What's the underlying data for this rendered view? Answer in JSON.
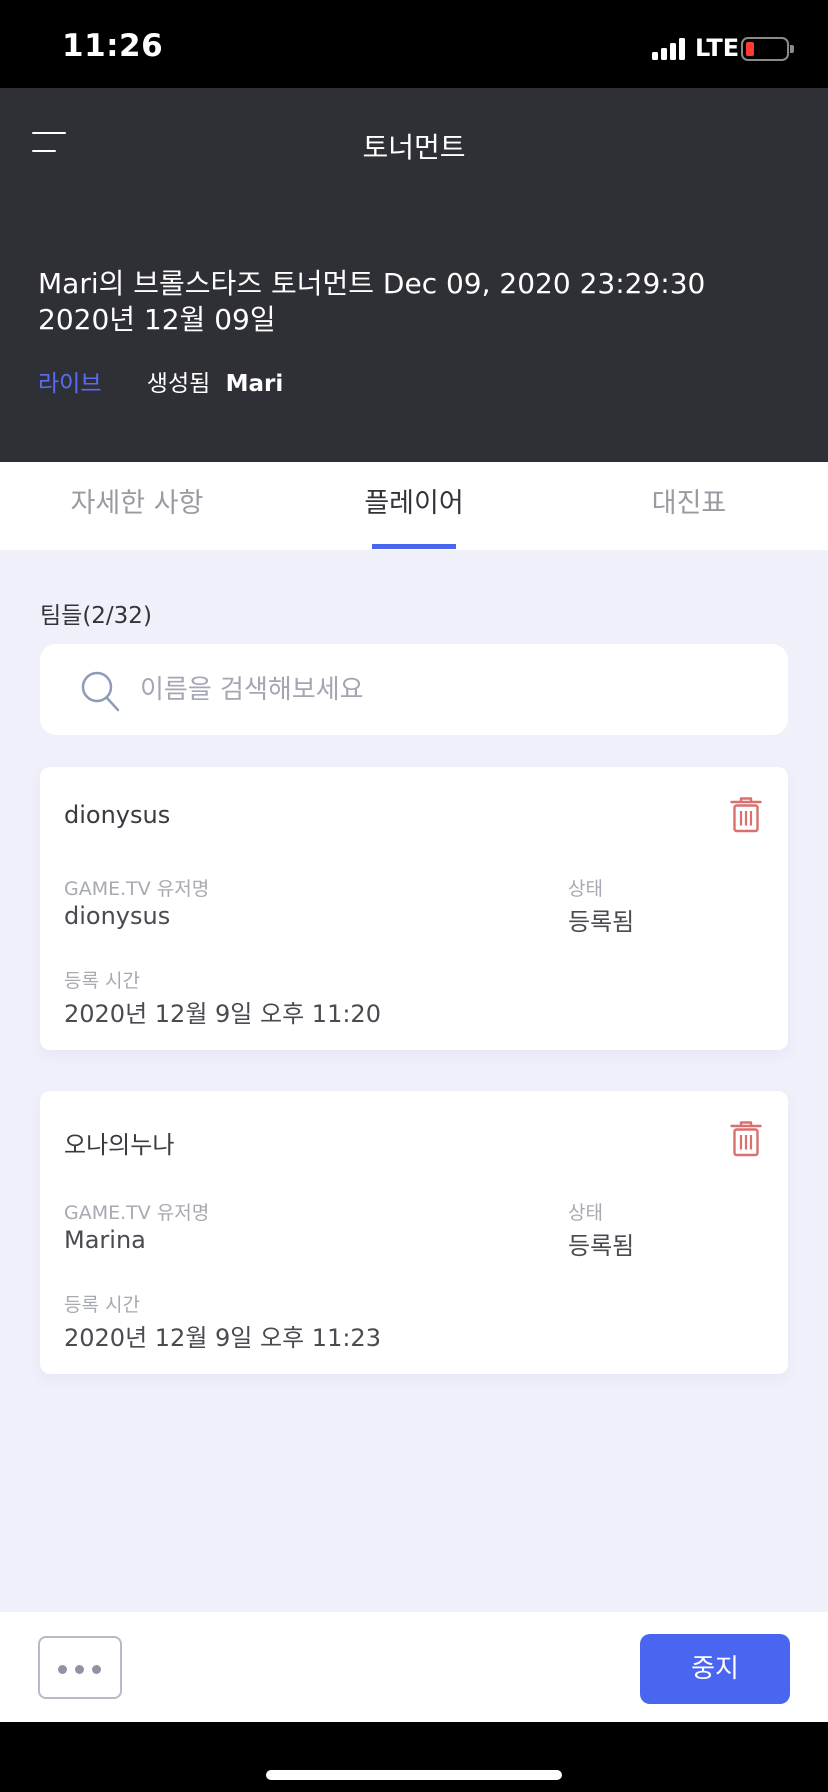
{
  "status_bar": {
    "time": "11:26",
    "network": "LTE",
    "battery_level": 0.1
  },
  "header": {
    "title": "토너먼트",
    "tournament_name": "Mari의 브롤스타즈 토너먼트 Dec 09, 2020 23:29:30",
    "tournament_date": "2020년 12월 09일",
    "status": "라이브",
    "created_by_label": "생성됨",
    "creator": "Mari"
  },
  "tabs": [
    {
      "label": "자세한 사항",
      "active": false
    },
    {
      "label": "플레이어",
      "active": true
    },
    {
      "label": "대진표",
      "active": false
    }
  ],
  "teams": {
    "label": "팀들(2/32)",
    "search_placeholder": "이름을 검색해보세요",
    "items": [
      {
        "name": "dionysus",
        "username_label": "GAME.TV 유저명",
        "username": "dionysus",
        "status_label": "상태",
        "status": "등록됨",
        "registered_label": "등록 시간",
        "registered_time": "2020년 12월 9일 오후 11:20"
      },
      {
        "name": "오나의누나",
        "username_label": "GAME.TV 유저명",
        "username": "Marina",
        "status_label": "상태",
        "status": "등록됨",
        "registered_label": "등록 시간",
        "registered_time": "2020년 12월 9일 오후 11:23"
      }
    ]
  },
  "bottom_bar": {
    "more_icon": "more-horizontal-icon",
    "stop_label": "중지"
  },
  "colors": {
    "accent": "#4a66f0",
    "header_bg": "#2f2f36",
    "page_bg": "#eff0fa",
    "trash": "#d9706e"
  }
}
